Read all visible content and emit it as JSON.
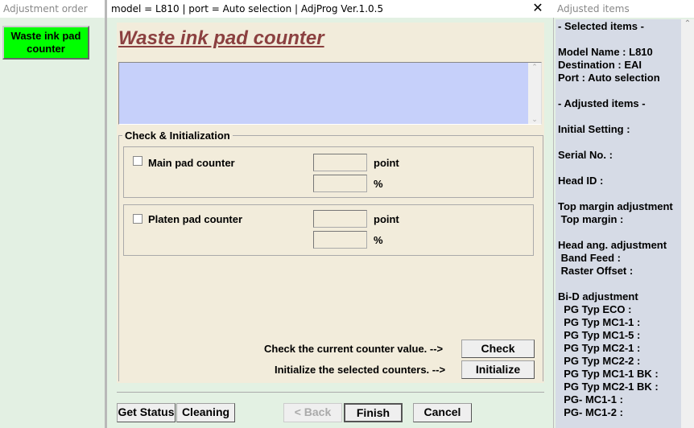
{
  "left_panel": {
    "title": "Adjustment order",
    "item": "Waste ink pad counter"
  },
  "dialog": {
    "title": "model = L810 | port = Auto selection | AdjProg Ver.1.0.5",
    "heading": "Waste ink pad counter",
    "group_label": "Check & Initialization",
    "main_pad": {
      "label": "Main pad counter",
      "point_value": "",
      "percent_value": "",
      "unit_point": "point",
      "unit_percent": "%"
    },
    "platen_pad": {
      "label": "Platen pad counter",
      "point_value": "",
      "percent_value": "",
      "unit_point": "point",
      "unit_percent": "%"
    },
    "check_text": "Check the current counter value. -->",
    "check_button": "Check",
    "init_text": "Initialize the selected counters. -->",
    "init_button": "Initialize",
    "get_status": "Get Status",
    "cleaning": "Cleaning",
    "back": "< Back",
    "finish": "Finish",
    "cancel": "Cancel"
  },
  "right_panel": {
    "title": "Adjusted items",
    "lines": [
      "- Selected items -",
      "Model Name : L810",
      "Destination : EAI",
      "Port : Auto selection",
      "- Adjusted items -",
      "Initial Setting :",
      "Serial No. :",
      "Head ID :",
      "Top margin adjustment",
      " Top margin :",
      "Head ang. adjustment",
      " Band Feed :",
      " Raster Offset :",
      "Bi-D adjustment",
      "  PG Typ ECO :",
      "  PG Typ MC1-1 :",
      "  PG Typ MC1-5 :",
      "  PG Typ MC2-1 :",
      "  PG Typ MC2-2 :",
      "  PG Typ MC1-1 BK :",
      "  PG Typ MC2-1 BK :",
      "  PG- MC1-1 :",
      "  PG- MC1-2 :"
    ]
  }
}
